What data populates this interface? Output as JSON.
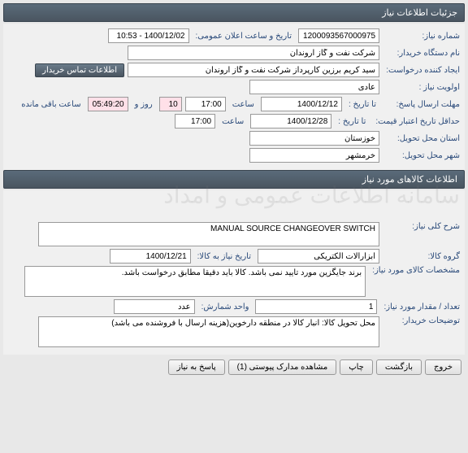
{
  "section1_title": "جزئیات اطلاعات نیاز",
  "need_number_label": "شماره نیاز:",
  "need_number": "1200093567000975",
  "public_announce_label": "تاریخ و ساعت اعلان عمومی:",
  "public_announce": "1400/12/02 - 10:53",
  "buyer_label": "نام دستگاه خریدار:",
  "buyer": "شرکت نفت و گاز اروندان",
  "creator_label": "ایجاد کننده درخواست:",
  "creator": "سید کریم برزین کارپرداز شرکت نفت و گاز اروندان",
  "contact_btn": "اطلاعات تماس خریدار",
  "priority_label": "اولویت نیاز :",
  "priority": "عادی",
  "deadline_label": "مهلت ارسال پاسخ:",
  "to_date_label": "تا تاریخ :",
  "deadline_date": "1400/12/12",
  "time_label": "ساعت",
  "deadline_time": "17:00",
  "days": "10",
  "days_and_label": "روز و",
  "remaining_time": "05:49:20",
  "remaining_label": "ساعت باقی مانده",
  "validity_label": "حداقل تاریخ اعتبار قیمت:",
  "validity_date": "1400/12/28",
  "validity_time": "17:00",
  "province_label": "استان محل تحویل:",
  "province": "خوزستان",
  "city_label": "شهر محل تحویل:",
  "city": "خرمشهر",
  "section2_title": "اطلاعات کالاهای مورد نیاز",
  "desc_label": "شرح کلی نیاز:",
  "desc": "MANUAL SOURCE CHANGEOVER SWITCH",
  "group_label": "گروه کالا:",
  "group": "ابزارآلات الکتریکی",
  "need_date_label": "تاریخ نیاز به کالا:",
  "need_date": "1400/12/21",
  "spec_label": "مشخصات کالای مورد نیاز:",
  "spec": "برند جایگزین مورد تایید نمی باشد. کالا باید دقیقا مطابق درخواست باشد.",
  "qty_label": "تعداد / مقدار مورد نیاز:",
  "qty": "1",
  "unit_label": "واحد شمارش:",
  "unit": "عدد",
  "notes_label": "توضیحات خریدار:",
  "notes": "محل تحویل کالا: انبار کالا در منطقه دارخوین(هزینه ارسال با فروشنده می باشد)",
  "btn_reply": "پاسخ به نیاز",
  "btn_attach": "مشاهده مدارک پیوستی (1)",
  "btn_print": "چاپ",
  "btn_back": "بازگشت",
  "btn_exit": "خروج"
}
